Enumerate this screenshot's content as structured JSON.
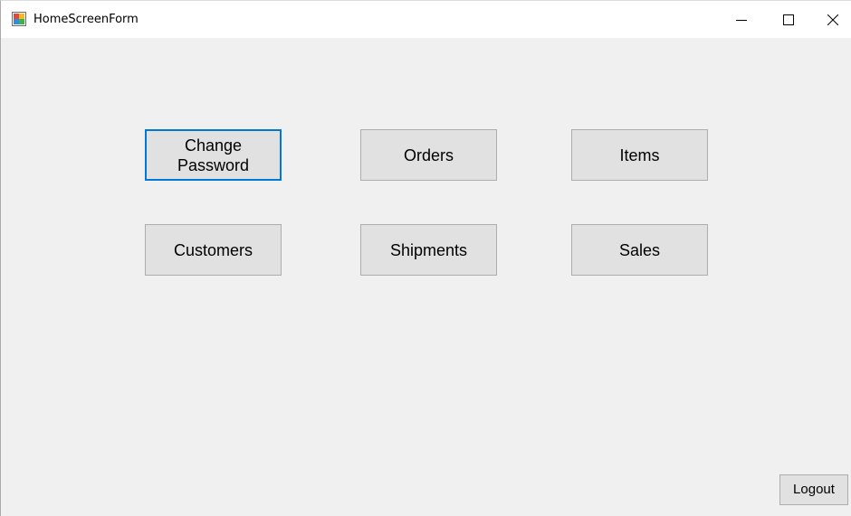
{
  "window": {
    "title": "HomeScreenForm"
  },
  "caption_buttons": {
    "minimize_icon": "minimize-icon",
    "maximize_icon": "maximize-icon",
    "close_icon": "close-icon"
  },
  "buttons": {
    "change_password": "Change\nPassword",
    "orders": "Orders",
    "items": "Items",
    "customers": "Customers",
    "shipments": "Shipments",
    "sales": "Sales",
    "logout": "Logout"
  },
  "colors": {
    "focus_border": "#0078d7",
    "button_face": "#e1e1e1",
    "form_background": "#f0f0f0"
  }
}
